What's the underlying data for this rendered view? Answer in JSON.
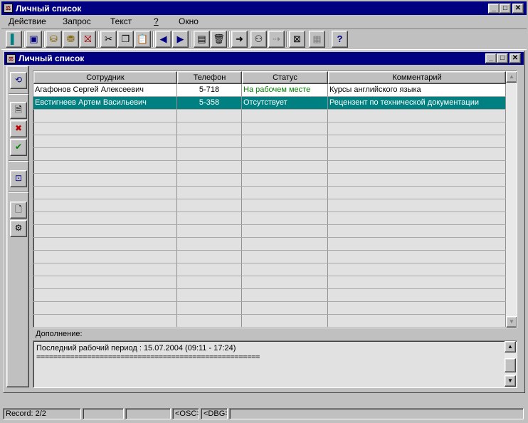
{
  "app": {
    "title": "Личный список"
  },
  "menu": {
    "items": [
      {
        "label": "Действие",
        "key": "Д"
      },
      {
        "label": "Запрос",
        "key": "З"
      },
      {
        "label": "Текст",
        "key": "Т"
      },
      {
        "label": "?",
        "key": "?"
      },
      {
        "label": "Окно",
        "key": "О"
      }
    ]
  },
  "toolbar": {
    "icons": [
      "exit-icon",
      "save-icon",
      "database-icon",
      "database-query-icon",
      "database-delete-icon",
      "cut-icon",
      "copy-icon",
      "paste-icon",
      "arrow-left-icon",
      "arrow-right-icon",
      "clipboard-icon",
      "trash-icon",
      "goto-icon",
      "binoculars-icon",
      "move-icon",
      "window-close-icon",
      "grid-icon",
      "help-icon"
    ]
  },
  "child": {
    "title": "Личный список"
  },
  "sidebar": {
    "icons": [
      "refresh-icon",
      "edit-card-icon",
      "delete-user-icon",
      "user-check-icon",
      "preview-icon",
      "document-icon",
      "user-settings-icon"
    ]
  },
  "grid": {
    "columns": [
      "Сотрудник",
      "Телефон",
      "Статус",
      "Комментарий"
    ],
    "rows": [
      {
        "employee": "Агафонов Сергей Алексеевич",
        "phone": "5-718",
        "status": "На рабочем месте",
        "comment": "Курсы английского языка"
      },
      {
        "employee": "Евстигнеев Артем Васильевич",
        "phone": "5-358",
        "status": "Отсутствует",
        "comment": "Рецензент по технической документации"
      }
    ],
    "selected_index": 1,
    "status_color": "#008000",
    "selection_color": "#008080"
  },
  "memo": {
    "label": "Дополнение:",
    "line1": "Последний рабочий период : 15.07.2004 (09:11 - 17:24)",
    "line2": "====================================================="
  },
  "status": {
    "record": "Record: 2/2",
    "p2": "",
    "p3": "",
    "osc": "<OSC>",
    "dbg": "<DBG>",
    "p6": ""
  }
}
